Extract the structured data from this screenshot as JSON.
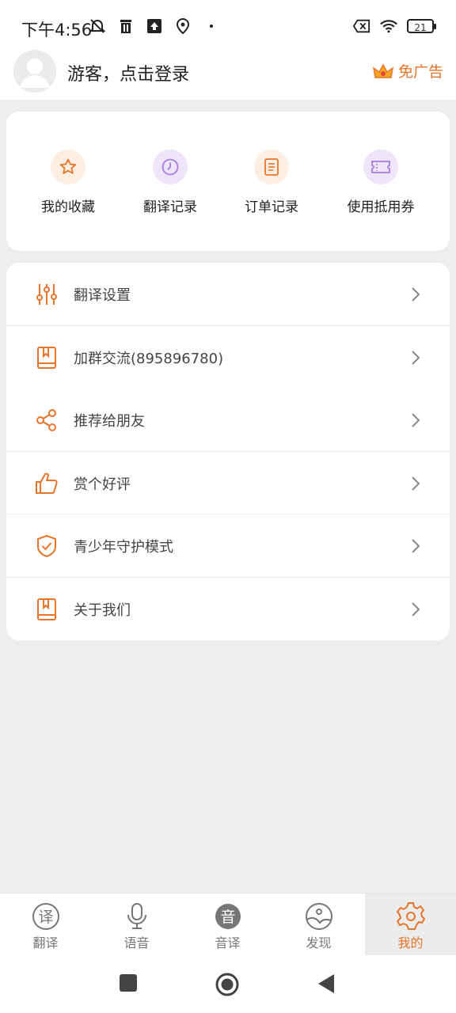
{
  "status": {
    "time": "下午4:56",
    "battery": "21"
  },
  "header": {
    "login_text": "游客，点击登录",
    "no_ads": "免广告"
  },
  "quick": [
    {
      "label": "我的收藏",
      "icon": "star-icon"
    },
    {
      "label": "翻译记录",
      "icon": "clock-icon"
    },
    {
      "label": "订单记录",
      "icon": "document-icon"
    },
    {
      "label": "使用抵用券",
      "icon": "ticket-icon"
    }
  ],
  "menu": [
    {
      "label": "翻译设置",
      "icon": "sliders-icon"
    },
    {
      "label": "加群交流(895896780)",
      "icon": "book-icon"
    },
    {
      "label": "推荐给朋友",
      "icon": "share-icon"
    },
    {
      "label": "赏个好评",
      "icon": "thumbs-up-icon"
    },
    {
      "label": "青少年守护模式",
      "icon": "shield-check-icon"
    },
    {
      "label": "关于我们",
      "icon": "book-icon"
    }
  ],
  "tabs": [
    {
      "label": "翻译",
      "icon_text": "译"
    },
    {
      "label": "语音",
      "icon": "microphone-icon"
    },
    {
      "label": "音译",
      "icon_text": "音"
    },
    {
      "label": "发现",
      "icon": "discover-icon"
    },
    {
      "label": "我的",
      "icon": "gear-icon"
    }
  ],
  "colors": {
    "accent": "#e8752a",
    "purple": "#a77be0"
  }
}
